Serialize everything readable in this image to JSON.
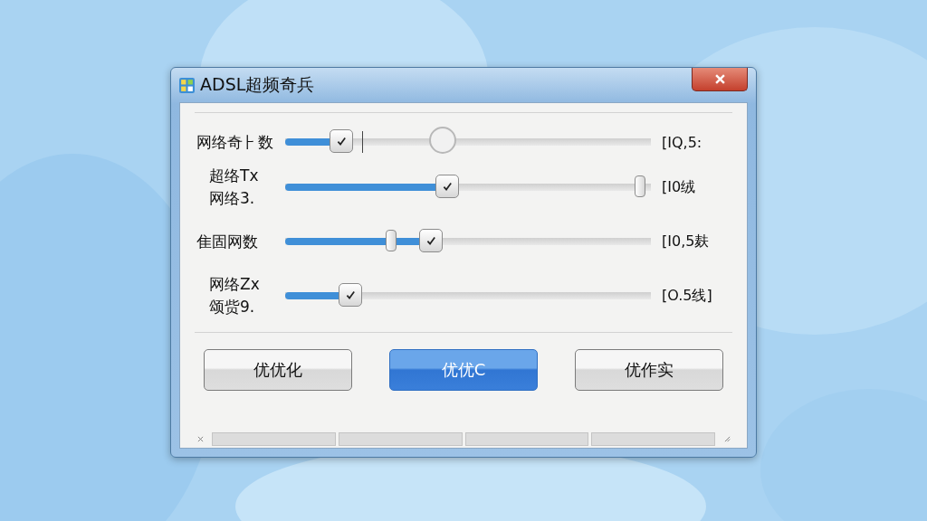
{
  "window": {
    "title": "ADSL超频奇兵"
  },
  "sliders": [
    {
      "label_lines": [
        "网络奇⺊数"
      ],
      "level": 0.155,
      "extra_marks": [
        {
          "kind": "tick",
          "level": 0.21
        },
        {
          "kind": "ring",
          "level": 0.43
        }
      ],
      "range": "[IQ,5:"
    },
    {
      "label_lines": [
        "超络Tx",
        "网络3."
      ],
      "level": 0.445,
      "extra_marks": [
        {
          "kind": "handle",
          "level": 0.97
        }
      ],
      "range": "[I0绒"
    },
    {
      "label_lines": [
        "隹固网数"
      ],
      "level": 0.4,
      "extra_marks": [
        {
          "kind": "handle",
          "level": 0.29
        }
      ],
      "range": "[I0,5麸"
    },
    {
      "label_lines": [
        "网络Zx",
        "颂赀9."
      ],
      "level": 0.18,
      "range": "[O.5线]"
    }
  ],
  "buttons": [
    {
      "label": "优优化",
      "selected": false
    },
    {
      "label": "优优C",
      "selected": true
    },
    {
      "label": "优作实",
      "selected": false
    }
  ]
}
